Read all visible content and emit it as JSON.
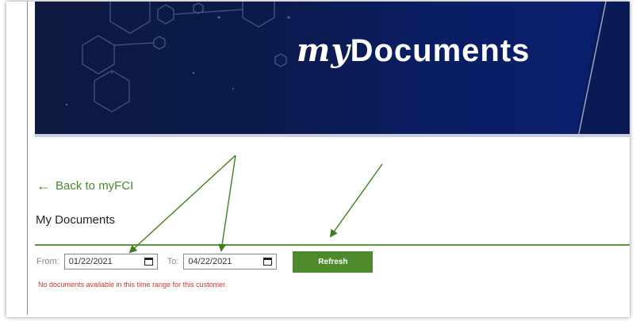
{
  "banner": {
    "title_my": "my",
    "title_rest": "Documents"
  },
  "nav": {
    "back_label": "Back to myFCI",
    "back_icon": "arrow-left-icon"
  },
  "page": {
    "title": "My Documents"
  },
  "filters": {
    "from_label": "From:",
    "from_value": "01/22/2021",
    "to_label": "To:",
    "to_value": "04/22/2021",
    "refresh_label": "Refresh"
  },
  "message": {
    "text": "No documents available in this time range for this customer."
  },
  "colors": {
    "accent": "#4e8a2c",
    "link": "#4a8a2e",
    "banner": "#0c1a4a",
    "error": "#c0392b",
    "annotation": "#3f7f1f"
  }
}
